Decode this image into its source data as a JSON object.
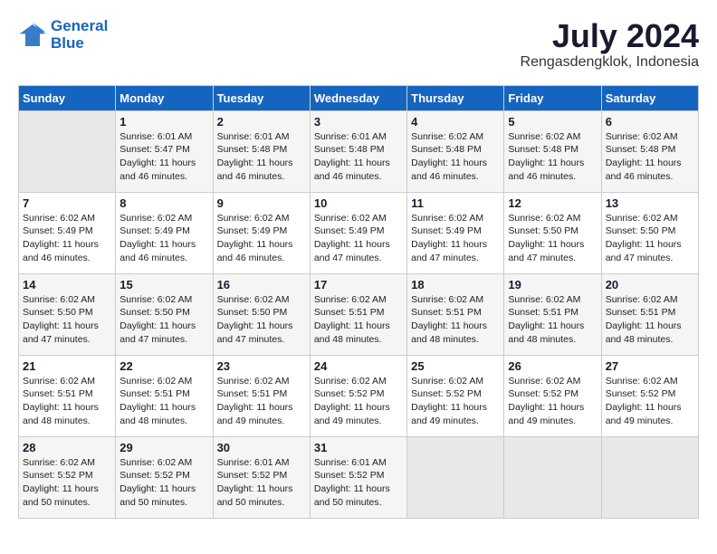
{
  "logo": {
    "line1": "General",
    "line2": "Blue"
  },
  "title": {
    "month_year": "July 2024",
    "location": "Rengasdengklok, Indonesia"
  },
  "headers": [
    "Sunday",
    "Monday",
    "Tuesday",
    "Wednesday",
    "Thursday",
    "Friday",
    "Saturday"
  ],
  "weeks": [
    [
      {
        "day": "",
        "text": ""
      },
      {
        "day": "1",
        "text": "Sunrise: 6:01 AM\nSunset: 5:47 PM\nDaylight: 11 hours\nand 46 minutes."
      },
      {
        "day": "2",
        "text": "Sunrise: 6:01 AM\nSunset: 5:48 PM\nDaylight: 11 hours\nand 46 minutes."
      },
      {
        "day": "3",
        "text": "Sunrise: 6:01 AM\nSunset: 5:48 PM\nDaylight: 11 hours\nand 46 minutes."
      },
      {
        "day": "4",
        "text": "Sunrise: 6:02 AM\nSunset: 5:48 PM\nDaylight: 11 hours\nand 46 minutes."
      },
      {
        "day": "5",
        "text": "Sunrise: 6:02 AM\nSunset: 5:48 PM\nDaylight: 11 hours\nand 46 minutes."
      },
      {
        "day": "6",
        "text": "Sunrise: 6:02 AM\nSunset: 5:48 PM\nDaylight: 11 hours\nand 46 minutes."
      }
    ],
    [
      {
        "day": "7",
        "text": "Sunrise: 6:02 AM\nSunset: 5:49 PM\nDaylight: 11 hours\nand 46 minutes."
      },
      {
        "day": "8",
        "text": "Sunrise: 6:02 AM\nSunset: 5:49 PM\nDaylight: 11 hours\nand 46 minutes."
      },
      {
        "day": "9",
        "text": "Sunrise: 6:02 AM\nSunset: 5:49 PM\nDaylight: 11 hours\nand 46 minutes."
      },
      {
        "day": "10",
        "text": "Sunrise: 6:02 AM\nSunset: 5:49 PM\nDaylight: 11 hours\nand 47 minutes."
      },
      {
        "day": "11",
        "text": "Sunrise: 6:02 AM\nSunset: 5:49 PM\nDaylight: 11 hours\nand 47 minutes."
      },
      {
        "day": "12",
        "text": "Sunrise: 6:02 AM\nSunset: 5:50 PM\nDaylight: 11 hours\nand 47 minutes."
      },
      {
        "day": "13",
        "text": "Sunrise: 6:02 AM\nSunset: 5:50 PM\nDaylight: 11 hours\nand 47 minutes."
      }
    ],
    [
      {
        "day": "14",
        "text": "Sunrise: 6:02 AM\nSunset: 5:50 PM\nDaylight: 11 hours\nand 47 minutes."
      },
      {
        "day": "15",
        "text": "Sunrise: 6:02 AM\nSunset: 5:50 PM\nDaylight: 11 hours\nand 47 minutes."
      },
      {
        "day": "16",
        "text": "Sunrise: 6:02 AM\nSunset: 5:50 PM\nDaylight: 11 hours\nand 47 minutes."
      },
      {
        "day": "17",
        "text": "Sunrise: 6:02 AM\nSunset: 5:51 PM\nDaylight: 11 hours\nand 48 minutes."
      },
      {
        "day": "18",
        "text": "Sunrise: 6:02 AM\nSunset: 5:51 PM\nDaylight: 11 hours\nand 48 minutes."
      },
      {
        "day": "19",
        "text": "Sunrise: 6:02 AM\nSunset: 5:51 PM\nDaylight: 11 hours\nand 48 minutes."
      },
      {
        "day": "20",
        "text": "Sunrise: 6:02 AM\nSunset: 5:51 PM\nDaylight: 11 hours\nand 48 minutes."
      }
    ],
    [
      {
        "day": "21",
        "text": "Sunrise: 6:02 AM\nSunset: 5:51 PM\nDaylight: 11 hours\nand 48 minutes."
      },
      {
        "day": "22",
        "text": "Sunrise: 6:02 AM\nSunset: 5:51 PM\nDaylight: 11 hours\nand 48 minutes."
      },
      {
        "day": "23",
        "text": "Sunrise: 6:02 AM\nSunset: 5:51 PM\nDaylight: 11 hours\nand 49 minutes."
      },
      {
        "day": "24",
        "text": "Sunrise: 6:02 AM\nSunset: 5:52 PM\nDaylight: 11 hours\nand 49 minutes."
      },
      {
        "day": "25",
        "text": "Sunrise: 6:02 AM\nSunset: 5:52 PM\nDaylight: 11 hours\nand 49 minutes."
      },
      {
        "day": "26",
        "text": "Sunrise: 6:02 AM\nSunset: 5:52 PM\nDaylight: 11 hours\nand 49 minutes."
      },
      {
        "day": "27",
        "text": "Sunrise: 6:02 AM\nSunset: 5:52 PM\nDaylight: 11 hours\nand 49 minutes."
      }
    ],
    [
      {
        "day": "28",
        "text": "Sunrise: 6:02 AM\nSunset: 5:52 PM\nDaylight: 11 hours\nand 50 minutes."
      },
      {
        "day": "29",
        "text": "Sunrise: 6:02 AM\nSunset: 5:52 PM\nDaylight: 11 hours\nand 50 minutes."
      },
      {
        "day": "30",
        "text": "Sunrise: 6:01 AM\nSunset: 5:52 PM\nDaylight: 11 hours\nand 50 minutes."
      },
      {
        "day": "31",
        "text": "Sunrise: 6:01 AM\nSunset: 5:52 PM\nDaylight: 11 hours\nand 50 minutes."
      },
      {
        "day": "",
        "text": ""
      },
      {
        "day": "",
        "text": ""
      },
      {
        "day": "",
        "text": ""
      }
    ]
  ]
}
